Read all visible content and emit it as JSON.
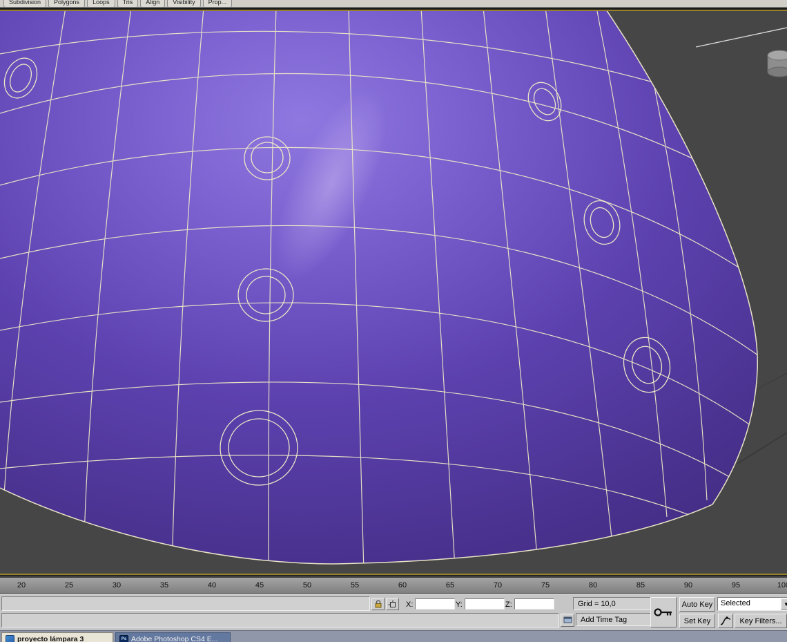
{
  "ribbon": {
    "tabs": [
      "Subdivision",
      "Polygons",
      "Loops",
      "Tris",
      "Align",
      "Visibility",
      "Prop..."
    ]
  },
  "viewport": {
    "colors": {
      "object_light": "#8f78e0",
      "object_dark": "#3e2a7c",
      "wireframe": "#ece7c6",
      "active_border": "#97822c",
      "background": "#464646"
    }
  },
  "timeline": {
    "labels": [
      "20",
      "25",
      "30",
      "35",
      "40",
      "45",
      "50",
      "55",
      "60",
      "65",
      "70",
      "75",
      "80",
      "85",
      "90",
      "95",
      "100"
    ]
  },
  "status_bar": {
    "coords": {
      "x_label": "X:",
      "x_value": "",
      "y_label": "Y:",
      "y_value": "",
      "z_label": "Z:",
      "z_value": ""
    },
    "grid": "Grid = 10,0",
    "add_time_tag": "Add Time Tag",
    "auto_key": "Auto Key",
    "set_key": "Set Key",
    "selected_set": "Selected",
    "key_filters": "Key Filters..."
  },
  "taskbar": {
    "apps": [
      {
        "label": "proyecto lámpara 3"
      },
      {
        "label": "Adobe Photoshop CS4 E...",
        "icon_text": "Ps"
      }
    ]
  }
}
